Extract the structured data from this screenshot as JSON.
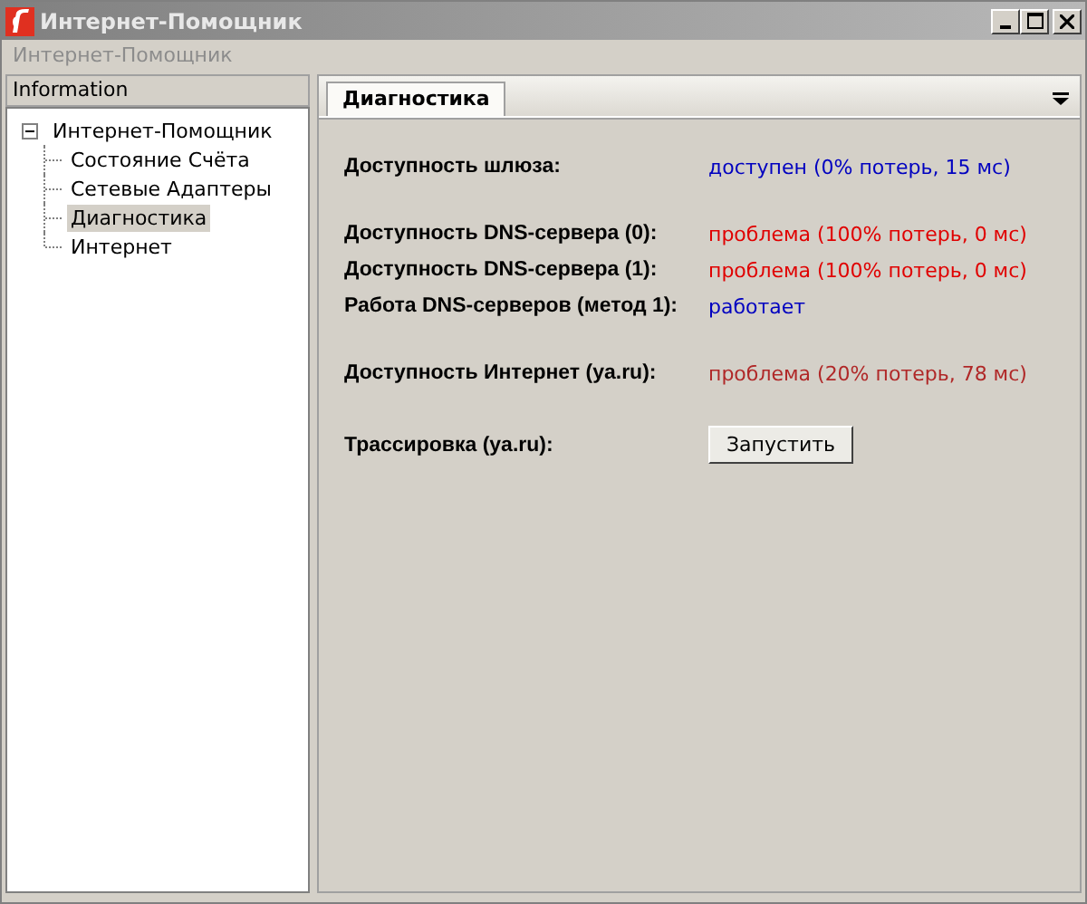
{
  "window": {
    "title": "Интернет-Помощник"
  },
  "menu": [
    {
      "label": "Интернет-Помощник",
      "disabled": true
    }
  ],
  "sidebar": {
    "header": "Information",
    "tree": [
      {
        "label": "Интернет-Помощник",
        "expanded": true,
        "selected": false,
        "children": [
          {
            "label": "Состояние Счёта",
            "selected": false
          },
          {
            "label": "Сетевые Адаптеры",
            "selected": false
          },
          {
            "label": "Диагностика",
            "selected": true
          },
          {
            "label": "Интернет",
            "selected": false
          }
        ]
      }
    ]
  },
  "tabs": [
    {
      "label": "Диагностика",
      "selected": true
    }
  ],
  "groups": [
    [
      {
        "kind": "status",
        "label": "Доступность шлюза:",
        "value": "доступен (0% потерь, 15 мс)",
        "color": "#0000c0"
      }
    ],
    [
      {
        "kind": "status",
        "label": "Доступность DNS-сервера (0):",
        "value": "проблема (100% потерь, 0 мс)",
        "color": "#e00000"
      },
      {
        "kind": "status",
        "label": "Доступность DNS-сервера (1):",
        "value": "проблема (100% потерь, 0 мс)",
        "color": "#e00000"
      },
      {
        "kind": "status",
        "label": "Работа DNS-серверов (метод 1):",
        "value": "работает",
        "color": "#0000c0"
      }
    ],
    [
      {
        "kind": "status",
        "label": "Доступность Интернет (ya.ru):",
        "value": "проблема (20% потерь, 78 мс)",
        "color": "#b02828"
      }
    ],
    [
      {
        "kind": "button",
        "label": "Трассировка (ya.ru):",
        "button": "Запустить"
      }
    ]
  ]
}
